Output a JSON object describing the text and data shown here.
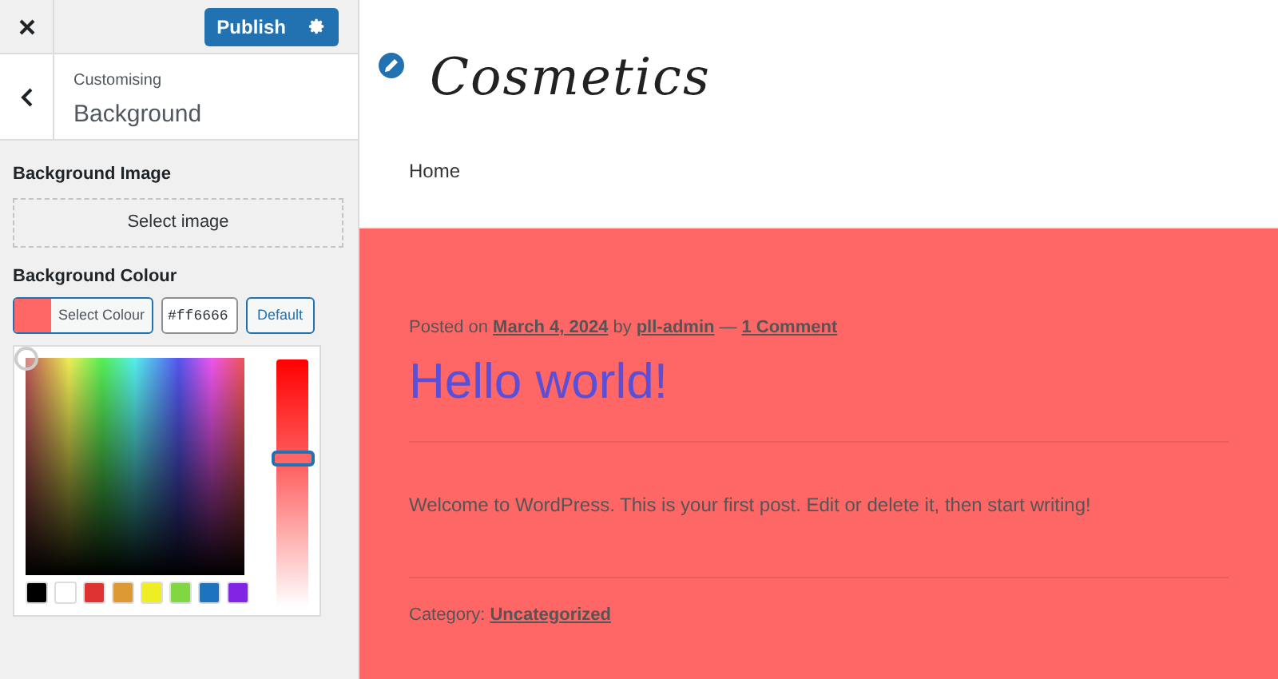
{
  "header": {
    "publish": "Publish"
  },
  "panel": {
    "breadcrumb": "Customising",
    "title": "Background"
  },
  "background_image": {
    "label": "Background Image",
    "button": "Select image"
  },
  "background_colour": {
    "label": "Background Colour",
    "select": "Select Colour",
    "value": "#ff6666",
    "color": "#ff6666",
    "default": "Default",
    "picker": {
      "swatches": [
        {
          "color": "#000000"
        },
        {
          "color": "#ffffff"
        },
        {
          "color": "#dd3333"
        },
        {
          "color": "#dd9933"
        },
        {
          "color": "#eeee22"
        },
        {
          "color": "#81d742"
        },
        {
          "color": "#1e73be"
        },
        {
          "color": "#8224e3"
        }
      ]
    }
  },
  "preview": {
    "logo": "Cosmetics",
    "nav": [
      "Home"
    ],
    "post": {
      "posted_on": "Posted on",
      "date": "March 4, 2024",
      "by": "by",
      "author": "pll-admin",
      "dash": "—",
      "comments": "1 Comment",
      "title": "Hello world!",
      "body": "Welcome to WordPress. This is your first post. Edit or delete it, then start writing!",
      "category_label": "Category:",
      "category": "Uncategorized"
    }
  }
}
